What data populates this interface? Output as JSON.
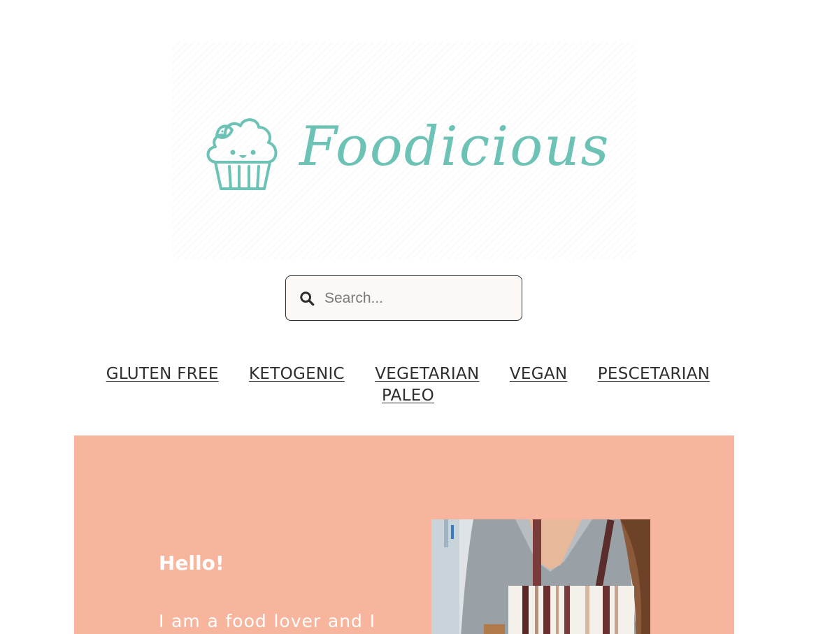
{
  "header": {
    "logo_text": "Foodicious",
    "logo_icon": "cupcake-logo-icon",
    "brand_color": "#6cc3b5"
  },
  "search": {
    "placeholder": "Search...",
    "icon": "search-icon"
  },
  "nav": {
    "items": [
      {
        "label": "GLUTEN FREE"
      },
      {
        "label": "KETOGENIC"
      },
      {
        "label": "VEGETARIAN"
      },
      {
        "label": "VEGAN"
      },
      {
        "label": "PESCETARIAN"
      },
      {
        "label": "PALEO"
      }
    ]
  },
  "about": {
    "title": "Hello!",
    "text": "I am a food lover and I",
    "background_color": "#f6b59c",
    "photo": "woman-in-striped-apron-photo"
  }
}
